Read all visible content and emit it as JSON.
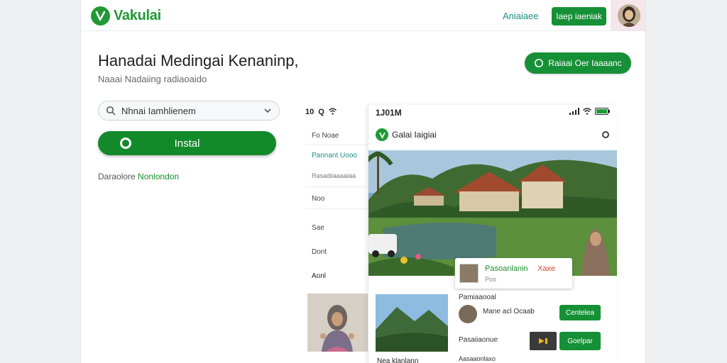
{
  "header": {
    "logo_text": "Vakulai",
    "link_label": "Aniaiaee",
    "button_label": "Iaep iaeniak"
  },
  "hero": {
    "title": "Hanadai Medingai Kenaninp,",
    "subtitle": "Naaai Nadaiing radiaoaido",
    "cta_label": "Raiaai Oer Iaaaanc",
    "search_value": "Nhnai Iamhlienem",
    "install_label": "Instal",
    "tagline_prefix": "Daraolore",
    "tagline_highlight": "Nonlondon"
  },
  "phone_left": {
    "status_time": "10",
    "status_glyph": "Q",
    "menu": [
      "Fo Noae",
      "Pannant Uooo",
      "Rasadiiaaaaiaa",
      "Noo",
      "Sae",
      "Dont",
      "Aonl"
    ],
    "active_index": 1
  },
  "phone_main": {
    "status_time": "1J01M",
    "app_title": "Galai Iaigiai",
    "float_card": {
      "name": "Pasoanlanin",
      "badge": "Xaxe",
      "sub": "Poo"
    },
    "lower_label": "Nea klanlann",
    "panel": {
      "title": "Pamiaaooal",
      "person": "Mane acl Ocaab",
      "button1": "Centelea",
      "row2": "Pasaiiaonue",
      "button2": "Goelpar",
      "row3": "Aasaaonlaxo"
    }
  },
  "colors": {
    "brand_green": "#169036",
    "teal": "#1a8f83",
    "alert_red": "#d2472b"
  },
  "icons": [
    "logo-icon",
    "search-icon",
    "chevron-down-icon",
    "whatsapp-icon",
    "signal-icon",
    "wifi-icon",
    "battery-icon",
    "settings-icon"
  ]
}
